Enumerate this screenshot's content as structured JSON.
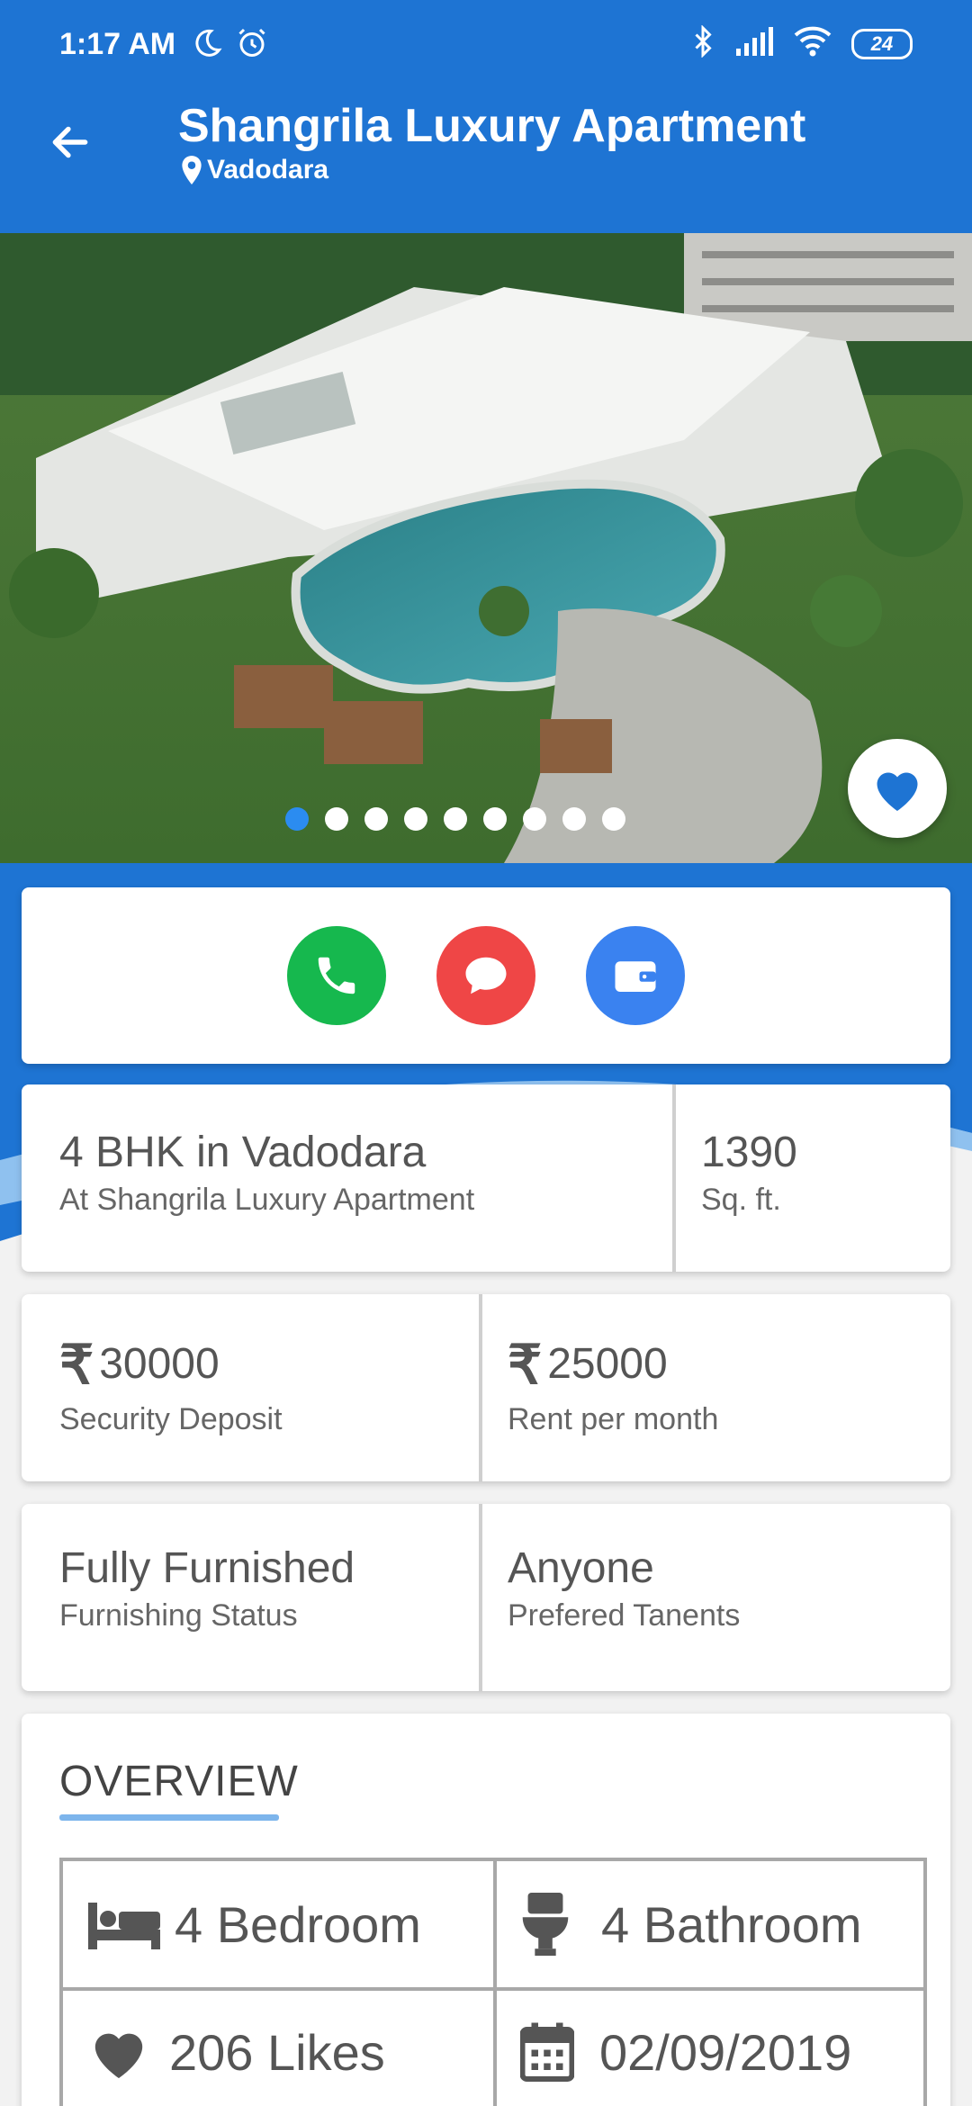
{
  "status_bar": {
    "time": "1:17 AM",
    "battery": "24",
    "icons": [
      "moon-icon",
      "alarm-icon",
      "bluetooth-icon",
      "signal-icon",
      "wifi-icon",
      "battery-icon"
    ]
  },
  "app_bar": {
    "title": "Shangrila Luxury Apartment",
    "location": "Vadodara",
    "back_icon": "arrow-left-icon",
    "location_icon": "map-pin-icon",
    "color": "#1e74d3"
  },
  "gallery": {
    "image_count": 9,
    "active_index": 0,
    "favorite_icon": "heart-icon"
  },
  "actions": [
    {
      "name": "call-button",
      "icon": "phone-icon",
      "color": "#16b84e"
    },
    {
      "name": "chat-button",
      "icon": "chat-icon",
      "color": "#ef4646"
    },
    {
      "name": "wallet-button",
      "icon": "wallet-icon",
      "color": "#3a82f0"
    }
  ],
  "property": {
    "type": "4 BHK in Vadodara",
    "building": "At Shangrila Luxury Apartment",
    "area_value": "1390",
    "area_unit": "Sq. ft.",
    "deposit_value": "30000",
    "deposit_label": "Security Deposit",
    "rent_value": "25000",
    "rent_label": "Rent per month",
    "furnishing_value": "Fully Furnished",
    "furnishing_label": "Furnishing Status",
    "tenants_value": "Anyone",
    "tenants_label": "Prefered Tanents",
    "currency_symbol": "₹"
  },
  "overview": {
    "title": "OVERVIEW",
    "items": [
      {
        "icon": "bed-icon",
        "text": "4 Bedroom"
      },
      {
        "icon": "toilet-icon",
        "text": "4 Bathroom"
      },
      {
        "icon": "heart-icon",
        "text": "206 Likes"
      },
      {
        "icon": "calendar-icon",
        "text": "02/09/2019"
      }
    ]
  }
}
